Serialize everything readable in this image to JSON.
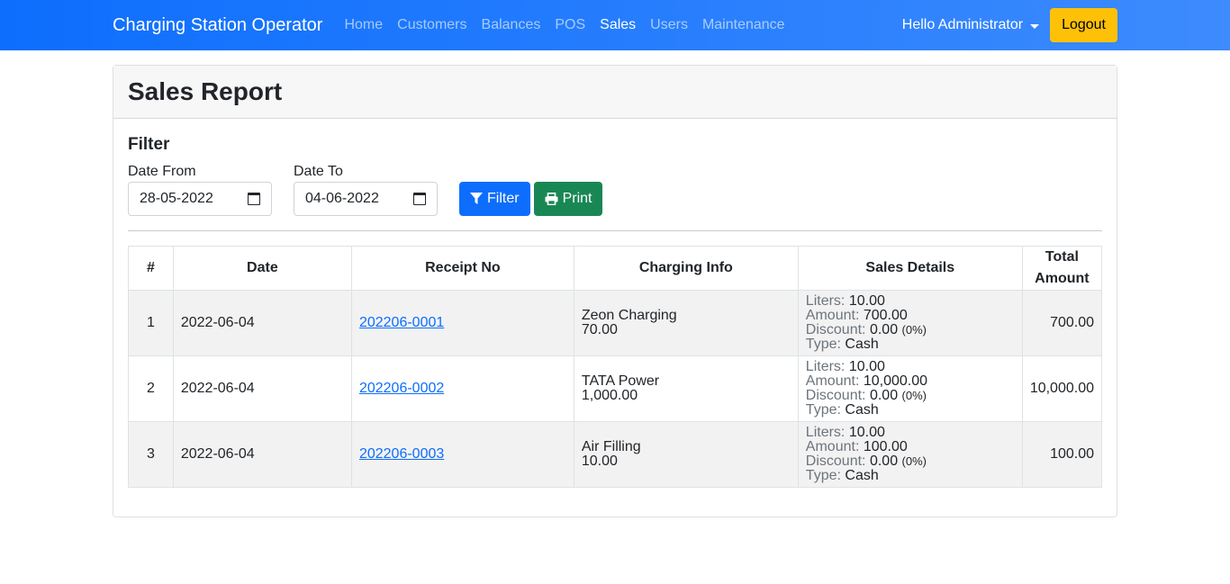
{
  "nav": {
    "brand": "Charging Station Operator",
    "links": [
      "Home",
      "Customers",
      "Balances",
      "POS",
      "Sales",
      "Users",
      "Maintenance"
    ],
    "active": "Sales",
    "user_greeting": "Hello Administrator",
    "logout_label": "Logout"
  },
  "page": {
    "title": "Sales Report"
  },
  "filter": {
    "title": "Filter",
    "date_from_label": "Date From",
    "date_from_value": "28-05-2022",
    "date_to_label": "Date To",
    "date_to_value": "04-06-2022",
    "filter_button": "Filter",
    "print_button": "Print"
  },
  "table": {
    "headers": [
      "#",
      "Date",
      "Receipt No",
      "Charging Info",
      "Sales Details",
      "Total Amount"
    ],
    "detail_labels": {
      "liters": "Liters:",
      "amount": "Amount:",
      "discount": "Discount:",
      "type": "Type:"
    },
    "rows": [
      {
        "num": "1",
        "date": "2022-06-04",
        "receipt": "202206-0001",
        "info_name": "Zeon Charging",
        "info_price": "70.00",
        "liters": "10.00",
        "amount": "700.00",
        "discount": "0.00",
        "discount_pct": "(0%)",
        "type": "Cash",
        "total": "700.00"
      },
      {
        "num": "2",
        "date": "2022-06-04",
        "receipt": "202206-0002",
        "info_name": "TATA Power",
        "info_price": "1,000.00",
        "liters": "10.00",
        "amount": "10,000.00",
        "discount": "0.00",
        "discount_pct": "(0%)",
        "type": "Cash",
        "total": "10,000.00"
      },
      {
        "num": "3",
        "date": "2022-06-04",
        "receipt": "202206-0003",
        "info_name": "Air Filling",
        "info_price": "10.00",
        "liters": "10.00",
        "amount": "100.00",
        "discount": "0.00",
        "discount_pct": "(0%)",
        "type": "Cash",
        "total": "100.00"
      }
    ]
  }
}
